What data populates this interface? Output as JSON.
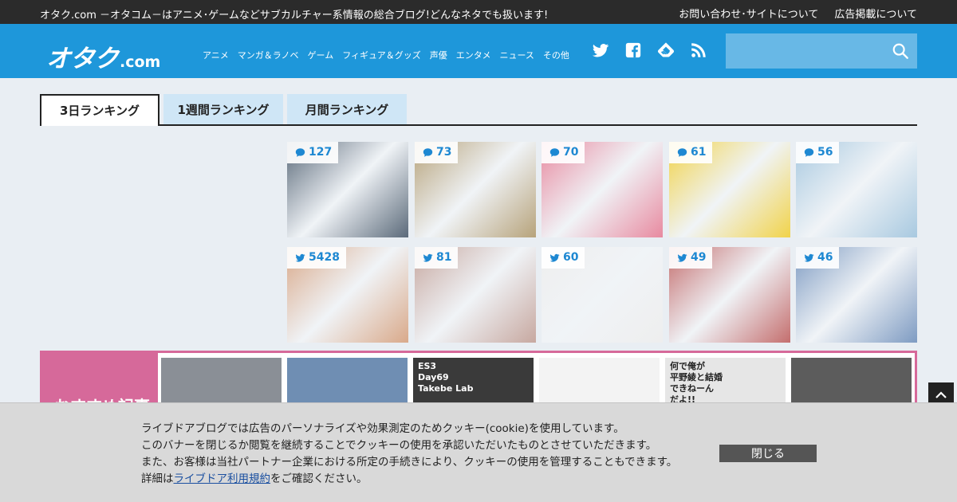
{
  "topbar": {
    "tagline": "オタク.com －オタコム－はアニメ･ゲームなどサブカルチャー系情報の総合ブログ!どんなネタでも扱います!",
    "links": [
      "お問い合わせ･サイトについて",
      "広告掲載について"
    ]
  },
  "header": {
    "logo_main": "オタク",
    "logo_suffix": ".com",
    "nav": [
      "アニメ",
      "マンガ＆ラノベ",
      "ゲーム",
      "フィギュア＆グッズ",
      "声優",
      "エンタメ",
      "ニュース",
      "その他"
    ],
    "social_icons": [
      "twitter-icon",
      "facebook-icon",
      "feedly-icon",
      "rss-icon"
    ],
    "search_placeholder": ""
  },
  "tabs": [
    {
      "label": "3日ランキング",
      "active": true
    },
    {
      "label": "1週間ランキング",
      "active": false
    },
    {
      "label": "月間ランキング",
      "active": false
    }
  ],
  "ranking": {
    "comment_row": [
      {
        "count": "127",
        "color": "#5b6a7a"
      },
      {
        "count": "73",
        "color": "#b7a37b"
      },
      {
        "count": "70",
        "color": "#e88aa0"
      },
      {
        "count": "61",
        "color": "#f1d34a"
      },
      {
        "count": "56",
        "color": "#a8c9e0"
      }
    ],
    "tweet_row": [
      {
        "count": "5428",
        "color": "#d9a98a"
      },
      {
        "count": "81",
        "color": "#c7a8a0"
      },
      {
        "count": "60",
        "color": "#eeeeee"
      },
      {
        "count": "49",
        "color": "#c46e6e"
      },
      {
        "count": "46",
        "color": "#7e9bc2"
      }
    ]
  },
  "pickup": {
    "label": "おすすめ記事",
    "tiles": [
      {
        "caption": "",
        "color": "#8a8f96"
      },
      {
        "caption": "",
        "color": "#6f8eb3"
      },
      {
        "caption": "ES3\nDay69\nTakebe Lab",
        "color": "#3a3a3a"
      },
      {
        "caption": "",
        "color": "#f3f3f3"
      },
      {
        "caption": "何で俺が\n平野綾と結婚\nできねーん\nだよ!!",
        "color": "#e6e6e6"
      },
      {
        "caption": "",
        "color": "#5c5c5c"
      }
    ]
  },
  "cookie": {
    "line1": "ライブドアブログでは広告のパーソナライズや効果測定のためクッキー(cookie)を使用しています。",
    "line2": "このバナーを閉じるか閲覧を継続することでクッキーの使用を承認いただいたものとさせていただきます。",
    "line3": "また、お客様は当社パートナー企業における所定の手続きにより、クッキーの使用を管理することもできます。",
    "line4_prefix": "詳細は",
    "line4_link": "ライブドア利用規約",
    "line4_suffix": "をご確認ください。",
    "close_label": "閉じる"
  }
}
